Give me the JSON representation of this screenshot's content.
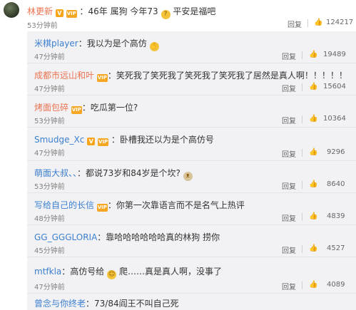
{
  "top": {
    "user": "林更新",
    "text": "：46年 属狗 今年73",
    "text2": "平安是福吧",
    "time": "53分钟前",
    "reply": "回复",
    "likes": "124217"
  },
  "replies": [
    {
      "user": "米棋player",
      "text": "：我以为是个高仿",
      "time": "47分钟前",
      "reply": "回复",
      "likes": "19489",
      "badges": [],
      "emoji": "hands"
    },
    {
      "user": "成都市远山和叶",
      "text": "：笑死我了笑死我了笑死我了笑死我了居然是真人啊！！！！！",
      "time": "47分钟前",
      "reply": "回复",
      "likes": "15604",
      "badges": [
        "vip"
      ],
      "emoji": ""
    },
    {
      "user": "烤面包碎",
      "text": "：吃瓜第一位?",
      "time": "53分钟前",
      "reply": "回复",
      "likes": "10364",
      "badges": [
        "vip"
      ],
      "emoji": ""
    },
    {
      "user": "Smudge_Xc",
      "text": "：卧槽我还以为是个高仿号",
      "time": "47分钟前",
      "reply": "回复",
      "likes": "9296",
      "badges": [
        "v",
        "vip"
      ],
      "emoji": ""
    },
    {
      "user": "萌面大叔、、",
      "text": "：都说73岁和84岁是个坎?",
      "time": "53分钟前",
      "reply": "回复",
      "likes": "8640",
      "badges": [],
      "emoji": "cat"
    },
    {
      "user": "写给自己的长信",
      "text": "：你第一次靠语言而不是名气上热评",
      "time": "48分钟前",
      "reply": "回复",
      "likes": "4839",
      "badges": [
        "vip"
      ],
      "emoji": ""
    },
    {
      "user": "GG_GGGLORIA",
      "text": "：靠哈哈哈哈哈哈真的林狗 捞你",
      "time": "45分钟前",
      "reply": "回复",
      "likes": "4527",
      "badges": [],
      "emoji": ""
    },
    {
      "user": "mtfkla",
      "text": "：高仿号给",
      "text2": "爬……真是真人啊，没事了",
      "time": "47分钟前",
      "reply": "回复",
      "likes": "4089",
      "badges": [],
      "emoji": "face"
    },
    {
      "user": "曾念与你终老",
      "text": "：73/84阎王不叫自己死",
      "time": "",
      "reply": "",
      "likes": "",
      "badges": [],
      "emoji": ""
    }
  ],
  "colors": {
    "name_orange": "#eb7350",
    "name_blue": "#3b7fcf",
    "panel_bg": "#f2f2f5"
  }
}
